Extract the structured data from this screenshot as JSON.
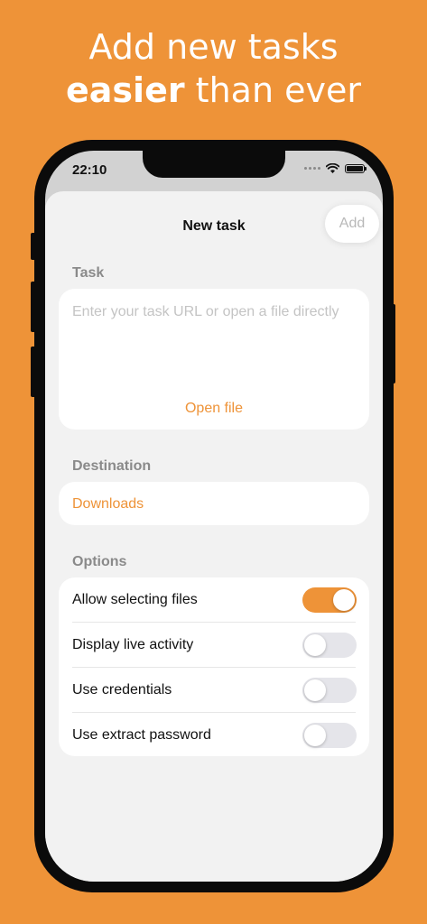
{
  "headline": {
    "line1": "Add new tasks",
    "line2_bold": "easier",
    "line2_rest": " than ever"
  },
  "status_bar": {
    "time": "22:10",
    "icons": [
      "signal-dots-icon",
      "wifi-icon",
      "battery-icon"
    ]
  },
  "sheet": {
    "title": "New task",
    "add_label": "Add",
    "task_label": "Task",
    "task_placeholder": "Enter your task URL or open a file directly",
    "task_value": "",
    "open_file_label": "Open file",
    "destination_label": "Destination",
    "destination_value": "Downloads",
    "options_label": "Options",
    "options": [
      {
        "label": "Allow selecting files",
        "on": true
      },
      {
        "label": "Display live activity",
        "on": false
      },
      {
        "label": "Use credentials",
        "on": false
      },
      {
        "label": "Use extract password",
        "on": false
      }
    ]
  },
  "colors": {
    "accent": "#EE9338",
    "background": "#EE9338",
    "sheet": "#F2F2F2",
    "toggle_off": "#E5E5EA"
  }
}
